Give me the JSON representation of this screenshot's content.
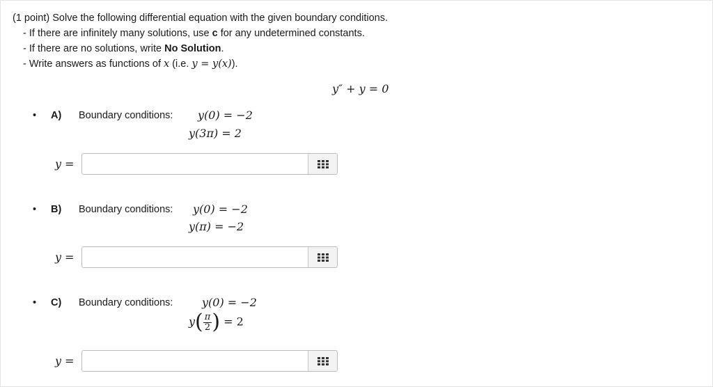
{
  "intro": {
    "title_prefix": "(1 point)",
    "title_text": " Solve the following differential equation with the given boundary conditions.",
    "line1": "- If there are infinitely many solutions, use ",
    "line1_bold": "c",
    "line1_end": " for any undetermined constants.",
    "line2": "- If there are no solutions, write ",
    "line2_bold": "No Solution",
    "line2_end": ".",
    "line3_start": "- Write answers as functions of ",
    "line3_var": "x",
    "line3_mid": " (i.e. ",
    "line3_math": "y = y(x)",
    "line3_end": ")."
  },
  "equation": "y″ + y = 0",
  "parts": [
    {
      "bullet": "•",
      "letter": "A)",
      "label": "Boundary conditions:",
      "bc1": "y(0) = −2",
      "bc2": "y(3π) = 2",
      "answer_label": "y =",
      "answer_value": ""
    },
    {
      "bullet": "•",
      "letter": "B)",
      "label": "Boundary conditions:",
      "bc1": "y(0) = −2",
      "bc2": "y(π) = −2",
      "answer_label": "y =",
      "answer_value": ""
    },
    {
      "bullet": "•",
      "letter": "C)",
      "label": "Boundary conditions:",
      "bc1": "y(0) = −2",
      "bc2_y": "y",
      "bc2_num": "π",
      "bc2_den": "2",
      "bc2_rhs": "= 2",
      "answer_label": "y =",
      "answer_value": ""
    }
  ],
  "icons": {
    "keypad": "keypad-grid-icon"
  },
  "colors": {
    "border": "#bcbcbc",
    "keypad_bg": "#f3f3f3",
    "text": "#1a1a1a"
  }
}
